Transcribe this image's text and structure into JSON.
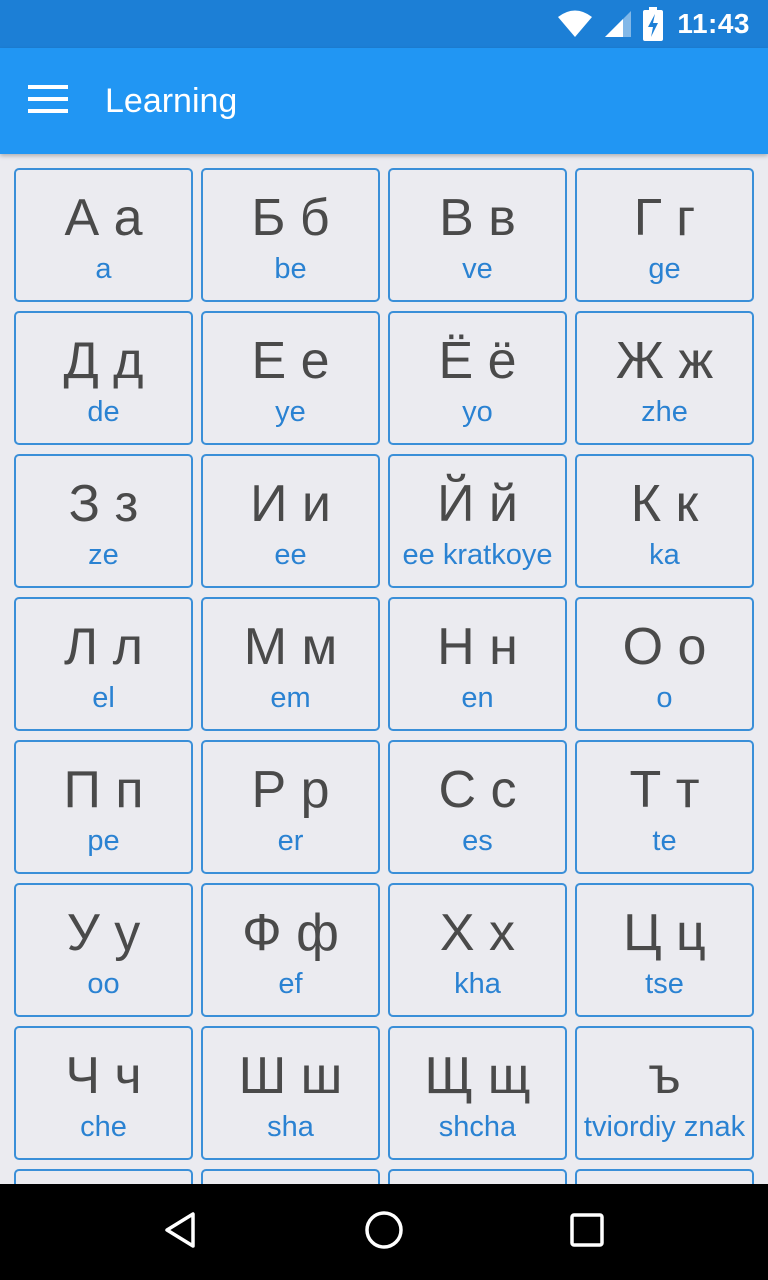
{
  "status_bar": {
    "time": "11:43"
  },
  "app_bar": {
    "title": "Learning"
  },
  "letters": [
    {
      "letter": "А а",
      "name": "a"
    },
    {
      "letter": "Б б",
      "name": "be"
    },
    {
      "letter": "В в",
      "name": "ve"
    },
    {
      "letter": "Г г",
      "name": "ge"
    },
    {
      "letter": "Д д",
      "name": "de"
    },
    {
      "letter": "Е е",
      "name": "ye"
    },
    {
      "letter": "Ё ё",
      "name": "yo"
    },
    {
      "letter": "Ж ж",
      "name": "zhe"
    },
    {
      "letter": "З з",
      "name": "ze"
    },
    {
      "letter": "И и",
      "name": "ee"
    },
    {
      "letter": "Й й",
      "name": "ee kratkoye"
    },
    {
      "letter": "К к",
      "name": "ka"
    },
    {
      "letter": "Л л",
      "name": "el"
    },
    {
      "letter": "М м",
      "name": "em"
    },
    {
      "letter": "Н н",
      "name": "en"
    },
    {
      "letter": "О о",
      "name": "o"
    },
    {
      "letter": "П п",
      "name": "pe"
    },
    {
      "letter": "Р р",
      "name": "er"
    },
    {
      "letter": "С с",
      "name": "es"
    },
    {
      "letter": "Т т",
      "name": "te"
    },
    {
      "letter": "У у",
      "name": "oo"
    },
    {
      "letter": "Ф ф",
      "name": "ef"
    },
    {
      "letter": "Х х",
      "name": "kha"
    },
    {
      "letter": "Ц ц",
      "name": "tse"
    },
    {
      "letter": "Ч ч",
      "name": "che"
    },
    {
      "letter": "Ш ш",
      "name": "sha"
    },
    {
      "letter": "Щ щ",
      "name": "shcha"
    },
    {
      "letter": "ъ",
      "name": "tviordiy znak"
    },
    {
      "letter": "",
      "name": ""
    },
    {
      "letter": "",
      "name": ""
    },
    {
      "letter": "",
      "name": ""
    },
    {
      "letter": "",
      "name": ""
    }
  ],
  "icons": {
    "menu": "hamburger-menu-icon",
    "wifi": "wifi-icon",
    "signal": "cell-signal-icon",
    "battery": "battery-charging-icon",
    "back": "back-triangle-icon",
    "home": "home-circle-icon",
    "recents": "recents-square-icon"
  },
  "colors": {
    "status_bar": "#1c7fd6",
    "app_bar": "#2196f3",
    "card_border": "#3a8fd8",
    "letter_text": "#4a4a4a",
    "translit_text": "#2a82d2",
    "background": "#ebebf0"
  }
}
